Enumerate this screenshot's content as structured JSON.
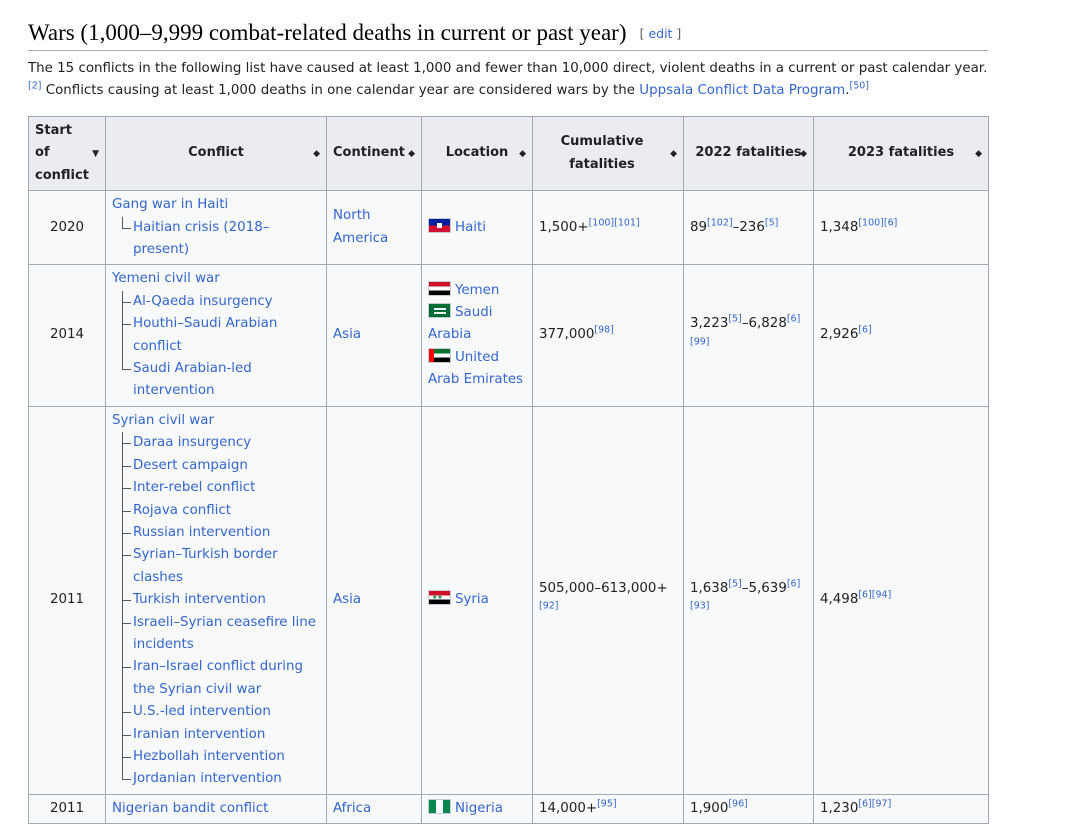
{
  "section": {
    "title": "Wars (1,000–9,999 combat-related deaths in current or past year)",
    "edit_open": "[ ",
    "edit_link": "edit",
    "edit_close": " ]"
  },
  "intro": {
    "part1": "The 15 conflicts in the following list have caused at least 1,000 and fewer than 10,000 direct, violent deaths in a current or past calendar year.",
    "ref1": "[2]",
    "part2": " Conflicts causing at least 1,000 deaths in one calendar year are considered wars by the ",
    "link": "Uppsala Conflict Data Program",
    "part3": ".",
    "ref2": "[50]"
  },
  "table": {
    "headers": {
      "start": "Start of conflict",
      "conflict": "Conflict",
      "continent": "Continent",
      "location": "Location",
      "cumulative": "Cumulative fatalities",
      "y2022": "2022 fatalities",
      "y2023": "2023 fatalities"
    },
    "sort_glyph": "◆",
    "sort_down_glyph": "▼",
    "rows": [
      {
        "start": "2020",
        "conflict": "Gang war in Haiti",
        "subs": [
          "Haitian crisis (2018–present)"
        ],
        "continent": "North America",
        "locations": [
          "Haiti"
        ],
        "cumulative": "1,500+",
        "cumulative_ref": "[100][101]",
        "f2022_a": "89",
        "f2022_a_ref": "[102]",
        "f2022_b": "–236",
        "f2022_b_ref": "[5]",
        "f2023": "1,348",
        "f2023_ref": "[100][6]"
      },
      {
        "start": "2014",
        "conflict": "Yemeni civil war",
        "subs": [
          "Al-Qaeda insurgency",
          "Houthi–Saudi Arabian conflict",
          "Saudi Arabian-led intervention"
        ],
        "continent": "Asia",
        "locations": [
          "Yemen",
          "Saudi Arabia",
          "United Arab Emirates"
        ],
        "cumulative": "377,000",
        "cumulative_ref": "[98]",
        "f2022_a": "3,223",
        "f2022_a_ref": "[5]",
        "f2022_b": "–6,828",
        "f2022_b_ref": "[6][99]",
        "f2023": "2,926",
        "f2023_ref": "[6]"
      },
      {
        "start": "2011",
        "conflict": "Syrian civil war",
        "subs": [
          "Daraa insurgency",
          "Desert campaign",
          "Inter-rebel conflict",
          "Rojava conflict",
          "Russian intervention",
          "Syrian–Turkish border clashes",
          "Turkish intervention",
          "Israeli–Syrian ceasefire line incidents",
          "Iran–Israel conflict during the Syrian civil war",
          "U.S.-led intervention",
          "Iranian intervention",
          "Hezbollah intervention",
          "Jordanian intervention"
        ],
        "continent": "Asia",
        "locations": [
          "Syria"
        ],
        "cumulative": "505,000–613,000+",
        "cumulative_ref": "[92]",
        "f2022_a": "1,638",
        "f2022_a_ref": "[5]",
        "f2022_b": "–5,639",
        "f2022_b_ref": "[6][93]",
        "f2023": "4,498",
        "f2023_ref": "[6][94]"
      },
      {
        "start": "2011",
        "conflict": "Nigerian bandit conflict",
        "subs": [],
        "continent": "Africa",
        "locations": [
          "Nigeria"
        ],
        "cumulative": "14,000+",
        "cumulative_ref": "[95]",
        "f2022_a": "1,900",
        "f2022_a_ref": "[96]",
        "f2022_b": "",
        "f2022_b_ref": "",
        "f2023": "1,230",
        "f2023_ref": "[6][97]"
      }
    ]
  },
  "flag_icons": [
    "haiti-flag-icon",
    "yemen-flag-icon",
    "saudi-arabia-flag-icon",
    "uae-flag-icon",
    "syria-flag-icon",
    "nigeria-flag-icon"
  ]
}
